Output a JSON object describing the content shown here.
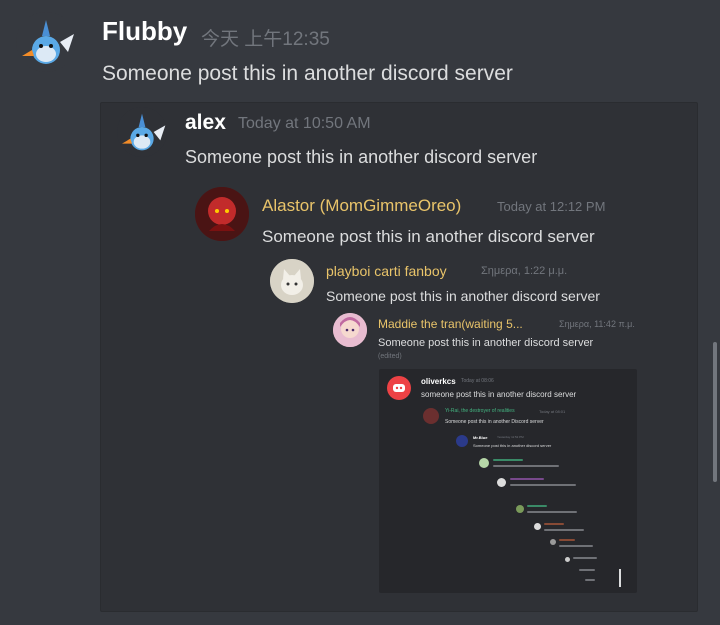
{
  "colors": {
    "bg": "#36393f",
    "embed_bg": "#2f3136",
    "username_white": "#ffffff",
    "username_yellow": "#e9c46a",
    "timestamp": "#72767d",
    "text": "#dcddde",
    "discord_red": "#ed4245"
  },
  "outer_message": {
    "username": "Flubby",
    "timestamp": "今天 上午12:35",
    "text": "Someone post this in another discord server",
    "avatar_icon": "mudkip-icon"
  },
  "level1": {
    "username": "alex",
    "timestamp": "Today at 10:50 AM",
    "text": "Someone post this in another discord server",
    "avatar_icon": "mudkip-icon"
  },
  "level2": {
    "username": "Alastor (MomGimmeOreo)",
    "timestamp": "Today at 12:12 PM",
    "text": "Someone post this in another discord server",
    "avatar_icon": "alastor-avatar-icon"
  },
  "level3": {
    "username": "playboi carti fanboy",
    "timestamp": "Σημερα, 1:22 μ.μ.",
    "text": "Someone post this in another discord server",
    "avatar_icon": "cat-avatar-icon"
  },
  "level4": {
    "username": "Maddie the tran(waiting 5...",
    "timestamp": "Σημερα, 11:42 π.μ.",
    "text": "Someone post this in another discord server",
    "edited": "(edited)",
    "avatar_icon": "anime-avatar-icon"
  },
  "level5": {
    "username": "oliverkcs",
    "timestamp": "Today at 08:06",
    "text": "someone post this in another discord server",
    "avatar_icon": "discord-logo-icon"
  },
  "level6": {
    "username": "Yi-Rai, the destroyer of realities",
    "timestamp": "Today at 08:01",
    "text": "Someone post this in another Discord server"
  },
  "level7": {
    "username": "Mr.Blue",
    "timestamp": "Yesterday 11:52 PM",
    "text": "Someone post this in another discord server"
  }
}
